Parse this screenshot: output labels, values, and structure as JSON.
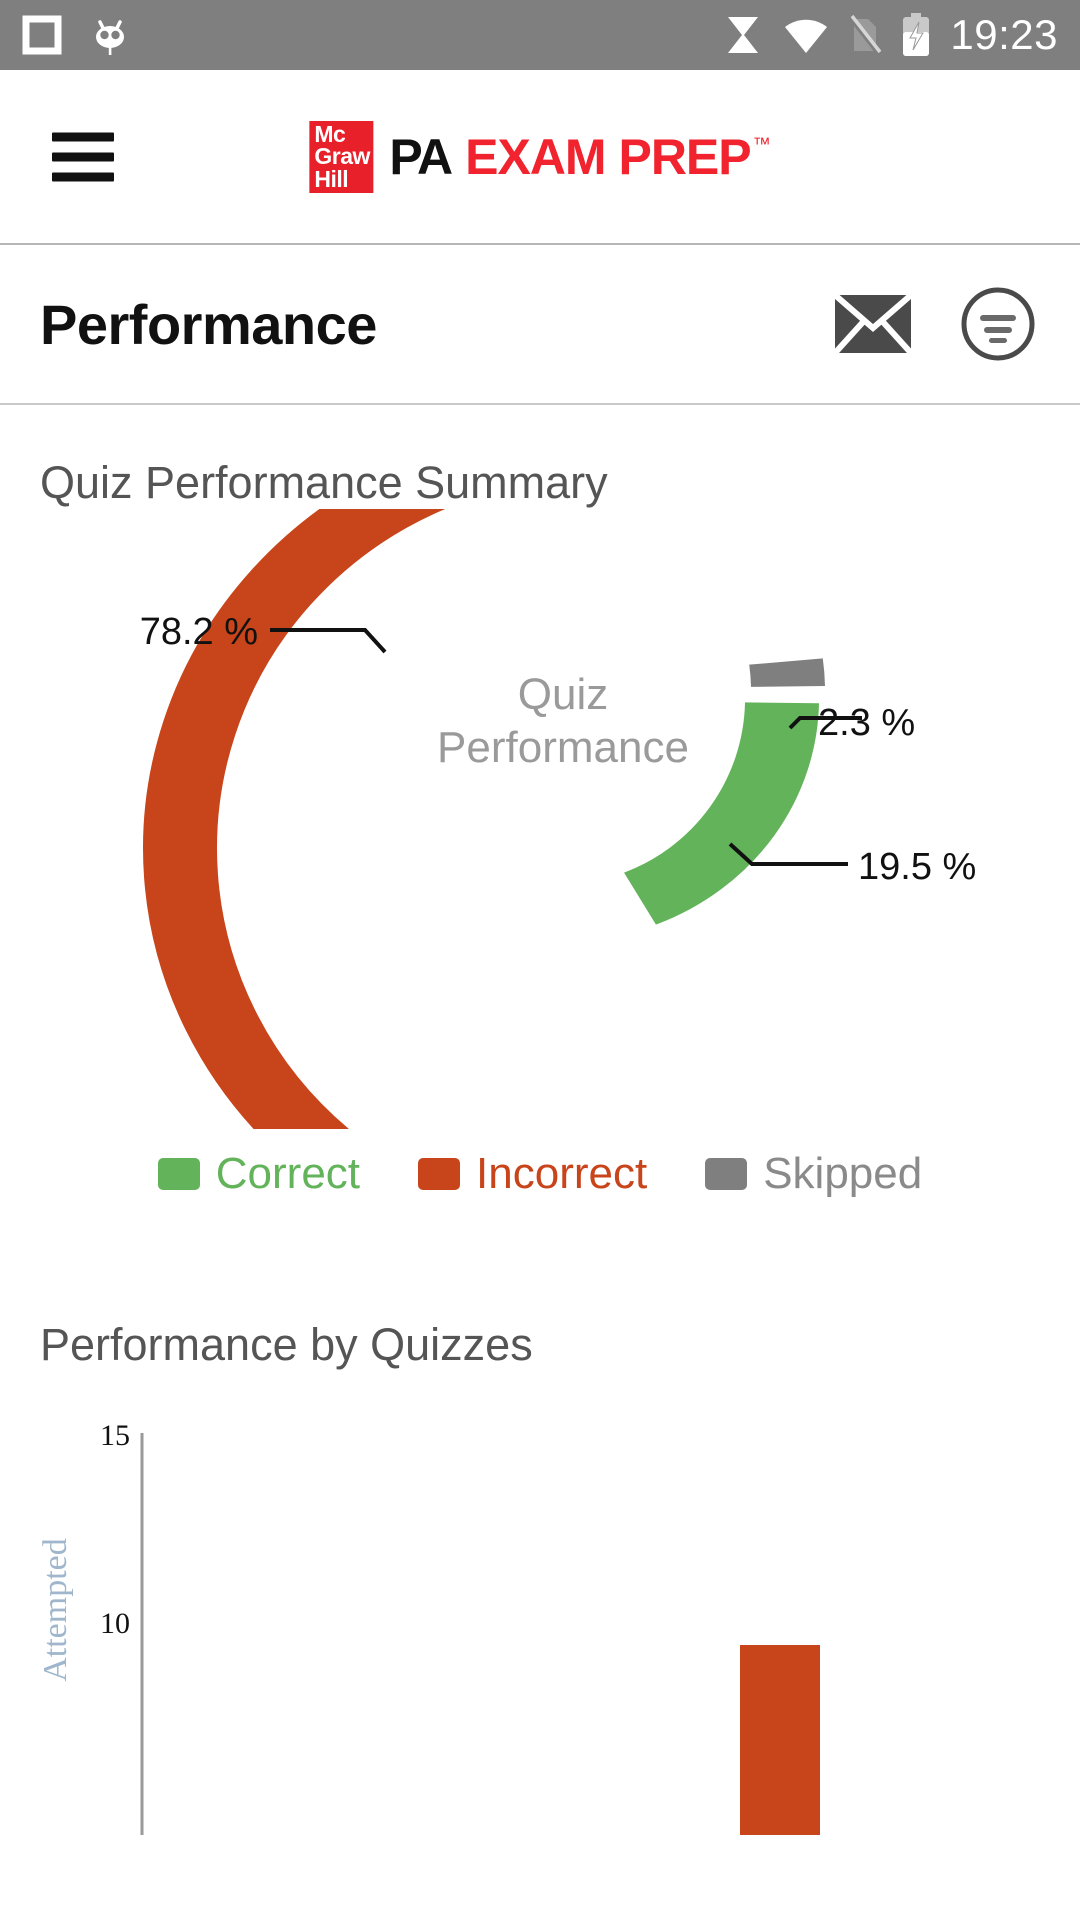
{
  "status_bar": {
    "left_icons": [
      "square-outline-icon",
      "cyanogenmod-mascot-icon"
    ],
    "right_icons": [
      "sync-icon",
      "wifi-icon",
      "sim-off-icon",
      "battery-charging-icon"
    ],
    "time": "19:23",
    "background_color": "#7f7f7f"
  },
  "app_bar": {
    "menu_icon": "hamburger-menu-icon",
    "logo": {
      "mark_line1": "Mc",
      "mark_line2": "Graw",
      "mark_line3": "Hill",
      "mark_color": "#e8202a",
      "word_pa": "PA",
      "word_exam_prep": "EXAM PREP",
      "trademark": "™",
      "accent_color": "#f0232e"
    }
  },
  "page_header": {
    "title": "Performance",
    "mail_icon": "mail-envelope-icon",
    "filter_icon": "filter-circle-icon"
  },
  "sections": {
    "summary_title": "Quiz Performance Summary",
    "quizzes_title": "Performance by Quizzes"
  },
  "chart_data": [
    {
      "type": "pie",
      "title": "Quiz Performance",
      "center_label_line1": "Quiz",
      "center_label_line2": "Performance",
      "categories": [
        "Correct",
        "Incorrect",
        "Skipped"
      ],
      "values": [
        19.5,
        78.2,
        2.3
      ],
      "value_labels": [
        "19.5 %",
        "78.2 %",
        "2.3 %"
      ],
      "colors": [
        "#63b35b",
        "#c8441a",
        "#7f7f7f"
      ],
      "donut": true,
      "legend": "bottom",
      "legend_entries": [
        {
          "label": "Correct",
          "color": "#63b35b"
        },
        {
          "label": "Incorrect",
          "color": "#c8441a"
        },
        {
          "label": "Skipped",
          "color": "#7f7f7f"
        }
      ]
    },
    {
      "type": "bar",
      "title": "Performance by Quizzes",
      "ylabel": "Attempted",
      "xlabel": "",
      "ytick_labels": [
        "15",
        "10"
      ],
      "ytick_values": [
        15,
        10
      ],
      "ylim": [
        0,
        15
      ],
      "grid": false,
      "categories": [
        ""
      ],
      "values": [
        9.6
      ],
      "bar_color": "#c8441a"
    }
  ],
  "colors": {
    "correct": "#63b35b",
    "incorrect": "#c8441a",
    "skipped": "#7f7f7f",
    "brand_red": "#f0232e",
    "status_bar": "#7f7f7f",
    "muted_text": "#555555"
  }
}
